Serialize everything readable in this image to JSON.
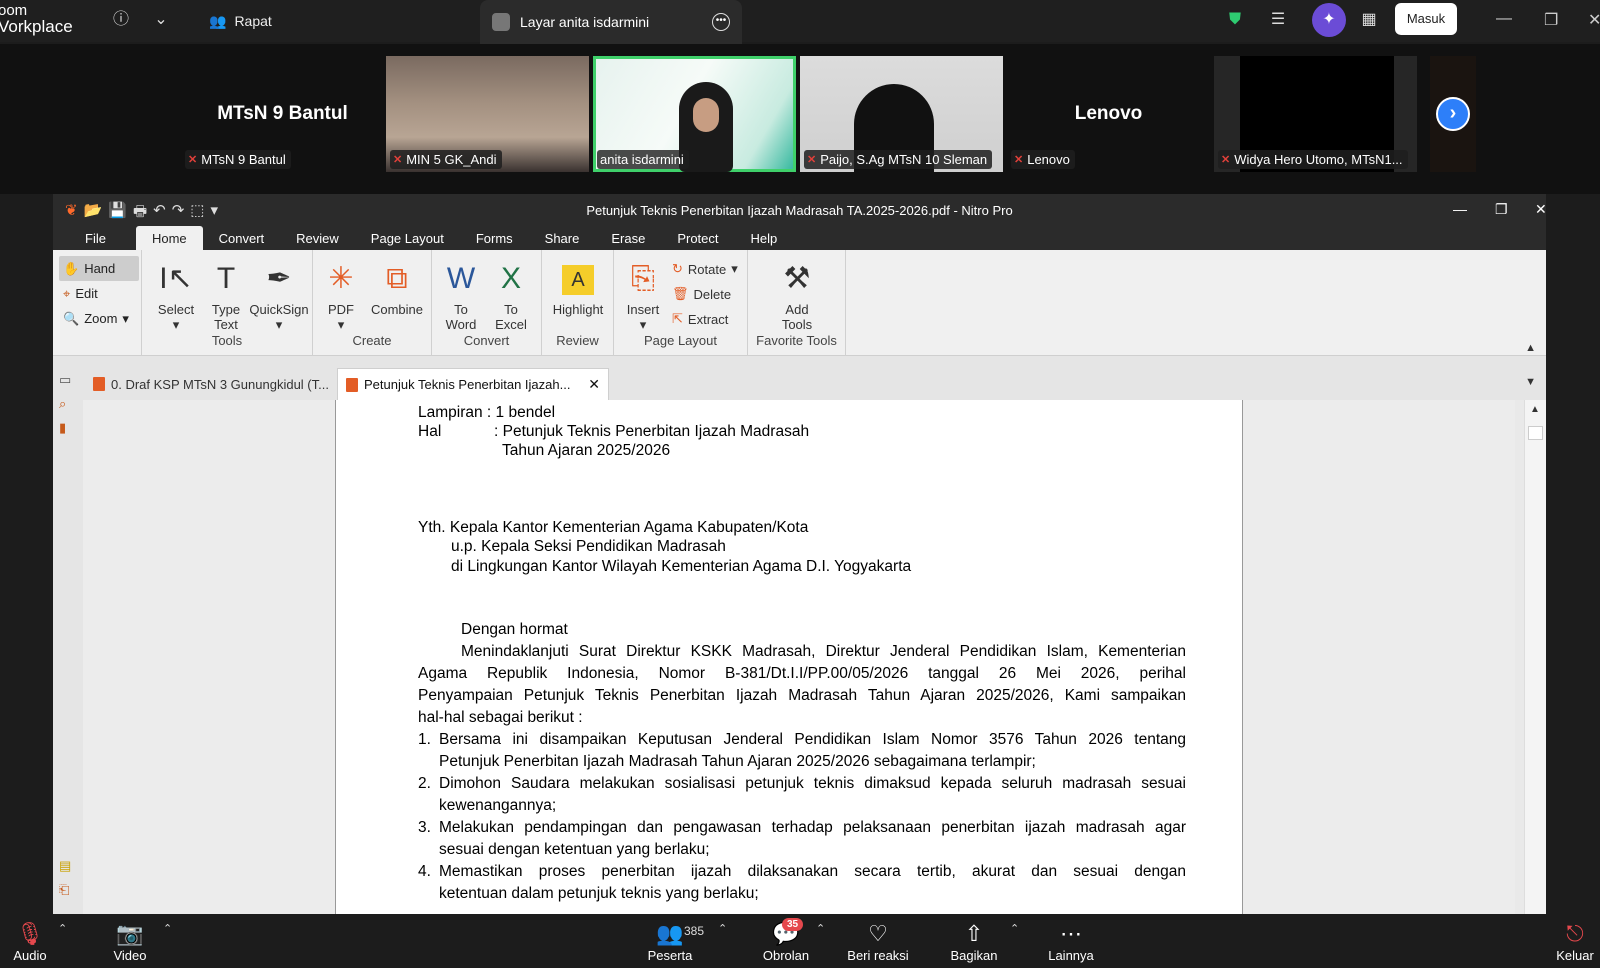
{
  "zoom": {
    "brand_line1": "oom",
    "brand_line2": "Vorkplace",
    "meeting_tab": "Rapat",
    "share_tab": "Layar anita isdarmini",
    "signin": "Masuk"
  },
  "participants": [
    {
      "name": "MTsN 9 Bantul",
      "label": "MTsN 9 Bantul"
    },
    {
      "name": "",
      "label": "MIN 5 GK_Andi"
    },
    {
      "name": "",
      "label": "anita isdarmini"
    },
    {
      "name": "",
      "label": "Paijo, S.Ag MTsN 10 Sleman"
    },
    {
      "name": "Lenovo",
      "label": "Lenovo"
    },
    {
      "name": "",
      "label": "Widya Hero Utomo, MTsN1..."
    }
  ],
  "nitro": {
    "title": "Petunjuk Teknis Penerbitan Ijazah Madrasah TA.2025-2026.pdf - Nitro Pro",
    "tabs": [
      "File",
      "Home",
      "Convert",
      "Review",
      "Page Layout",
      "Forms",
      "Share",
      "Erase",
      "Protect",
      "Help"
    ],
    "left_tools": [
      "Hand",
      "Edit",
      "Zoom"
    ],
    "tools": {
      "select": "Select",
      "type_text": "Type Text",
      "quicksign": "QuickSign",
      "group": "Tools"
    },
    "create": {
      "pdf": "PDF",
      "combine": "Combine",
      "group": "Create"
    },
    "convert": {
      "to_word": "To Word",
      "to_excel": "To Excel",
      "group": "Convert"
    },
    "review": {
      "highlight": "Highlight",
      "group": "Review"
    },
    "page_layout": {
      "insert": "Insert",
      "rotate": "Rotate",
      "delete": "Delete",
      "extract": "Extract",
      "group": "Page Layout"
    },
    "favorite": {
      "add_tools": "Add Tools",
      "group": "Favorite Tools"
    },
    "doc_tabs": [
      "0. Draf KSP MTsN 3 Gunungkidul (T...",
      "Petunjuk Teknis Penerbitan Ijazah..."
    ]
  },
  "doc": {
    "lampiran": "Lampiran : 1 bendel",
    "hal_label": "Hal",
    "hal_1": ": Petunjuk Teknis Penerbitan Ijazah Madrasah",
    "hal_2": "Tahun Ajaran 2025/2026",
    "yth_1": "Yth. Kepala Kantor Kementerian Agama Kabupaten/Kota",
    "yth_2": "u.p. Kepala Seksi Pendidikan Madrasah",
    "yth_3": "di Lingkungan Kantor Wilayah Kementerian Agama D.I. Yogyakarta",
    "salam": "Dengan hormat",
    "p1_l1": "Menindaklanjuti Surat Direktur KSKK Madrasah, Direktur Jenderal Pendidikan Islam, Kementerian",
    "p1_l2": "Agama Republik Indonesia, Nomor B-381/Dt.I.I/PP.00/05/2026 tanggal 26 Mei 2026, perihal",
    "p1_l3": "Penyampaian Petunjuk Teknis Penerbitan Ijazah Madrasah Tahun Ajaran 2025/2026, Kami sampaikan",
    "p1_l4": "hal-hal sebagai berikut :",
    "i1_l1": "Bersama ini disampaikan Keputusan Jenderal Pendidikan Islam Nomor 3576 Tahun 2026 tentang",
    "i1_l2": "Petunjuk Penerbitan Ijazah Madrasah Tahun Ajaran 2025/2026 sebagaimana terlampir;",
    "i2_l1": "Dimohon Saudara melakukan sosialisasi petunjuk teknis dimaksud kepada seluruh madrasah sesuai",
    "i2_l2": "kewenangannya;",
    "i3_l1": "Melakukan pendampingan dan pengawasan terhadap pelaksanaan penerbitan ijazah madrasah agar",
    "i3_l2": "sesuai dengan ketentuan yang berlaku;",
    "i4_l1": "Memastikan proses penerbitan ijazah dilaksanakan secara tertib, akurat dan sesuai dengan",
    "i4_l2": "ketentuan dalam petunjuk teknis yang berlaku;"
  },
  "bottom": {
    "audio": "Audio",
    "video": "Video",
    "participants": "Peserta",
    "participant_count": "385",
    "chat": "Obrolan",
    "chat_badge": "35",
    "react": "Beri reaksi",
    "share": "Bagikan",
    "more": "Lainnya",
    "leave": "Keluar"
  }
}
